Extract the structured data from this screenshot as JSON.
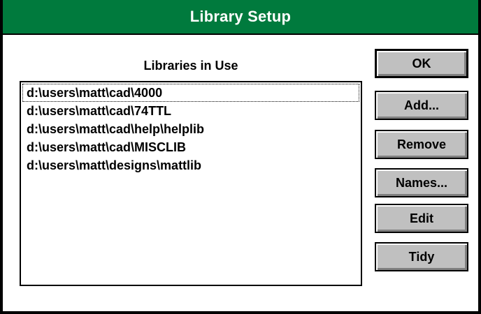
{
  "window": {
    "title": "Library Setup",
    "title_bar_color": "#007a3d"
  },
  "libraries": {
    "label": "Libraries in Use",
    "items": [
      "d:\\users\\matt\\cad\\4000",
      "d:\\users\\matt\\cad\\74TTL",
      "d:\\users\\matt\\cad\\help\\helplib",
      "d:\\users\\matt\\cad\\MISCLIB",
      "d:\\users\\matt\\designs\\mattlib"
    ]
  },
  "buttons": {
    "ok": "OK",
    "add": "Add...",
    "remove": "Remove",
    "names": "Names...",
    "edit": "Edit",
    "tidy": "Tidy"
  }
}
